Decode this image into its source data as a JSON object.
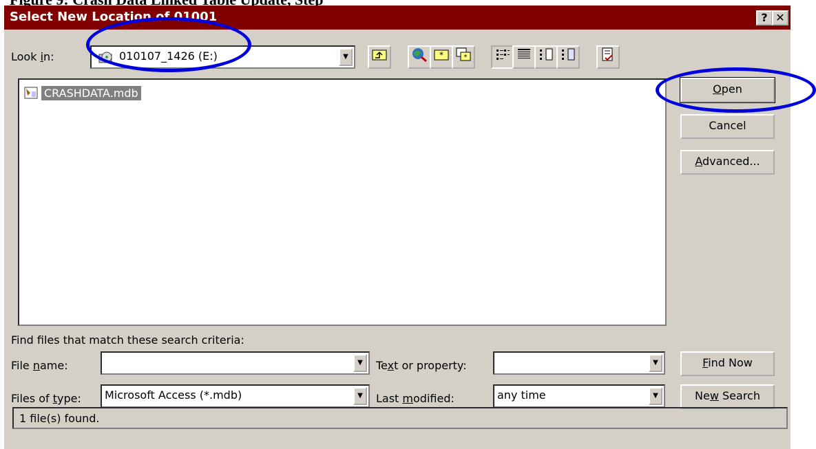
{
  "caption": "Figure 9: Crash Data Linked Table Update, Step",
  "dialog": {
    "title": "Select New Location of 01001",
    "help_label": "?",
    "close_label": "✕"
  },
  "lookin": {
    "label_pre": "Look ",
    "label_key": "i",
    "label_post": "n:",
    "value": "010107_1426 (E:)",
    "icon": "cd-drive-icon"
  },
  "toolbar": {
    "icons": [
      "up-one-level-icon",
      "search-web-icon",
      "new-folder-icon",
      "add-to-favorites-icon",
      "list-view-icon",
      "details-view-icon",
      "properties-view-icon",
      "preview-view-icon",
      "commands-icon"
    ]
  },
  "files": [
    {
      "name": "CRASHDATA.mdb",
      "icon": "access-db-icon"
    }
  ],
  "buttons": {
    "open_key": "O",
    "open_rest": "pen",
    "cancel": "Cancel",
    "advanced_key": "A",
    "advanced_rest": "dvanced...",
    "findnow_key": "F",
    "findnow_rest": "ind Now",
    "newsearch_pre": "Ne",
    "newsearch_key": "w",
    "newsearch_post": " Search"
  },
  "criteria": {
    "heading": "Find files that match these search criteria:",
    "filename_pre": "File ",
    "filename_key": "n",
    "filename_post": "ame:",
    "filename_value": "",
    "filetype_pre": "Files of ",
    "filetype_key": "t",
    "filetype_post": "ype:",
    "filetype_value": "Microsoft Access (*.mdb)",
    "text_pre": "Te",
    "text_key": "x",
    "text_post": "t or property:",
    "text_value": "",
    "modified_pre": "Last ",
    "modified_key": "m",
    "modified_post": "odified:",
    "modified_value": "any time"
  },
  "status_text": "1 file(s) found.",
  "colors": {
    "titlebar": "#800000",
    "dialog": "#d4d0c8",
    "annotation": "#0000dd"
  }
}
